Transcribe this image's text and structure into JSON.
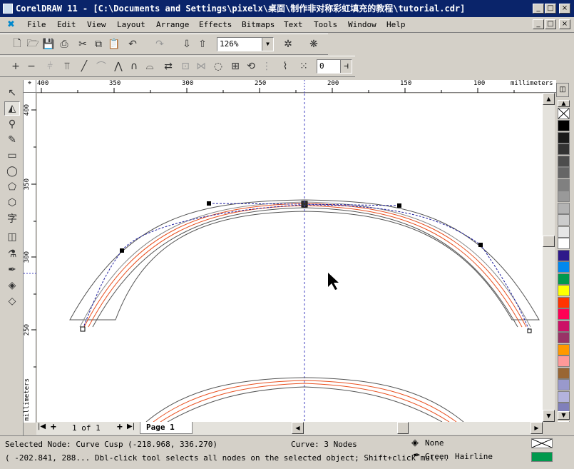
{
  "window": {
    "title": "CorelDRAW 11 - [C:\\Documents and Settings\\pixelx\\桌面\\制作非对称彩虹填充的教程\\tutorial.cdr]",
    "btn_min": "_",
    "btn_max": "□",
    "btn_close": "×"
  },
  "menu": [
    {
      "label": "File"
    },
    {
      "label": "Edit"
    },
    {
      "label": "View"
    },
    {
      "label": "Layout"
    },
    {
      "label": "Arrange"
    },
    {
      "label": "Effects"
    },
    {
      "label": "Bitmaps"
    },
    {
      "label": "Text"
    },
    {
      "label": "Tools"
    },
    {
      "label": "Window"
    },
    {
      "label": "Help"
    }
  ],
  "toolbar": {
    "zoom": "126%",
    "nudge": "0"
  },
  "ruler": {
    "unit": "millimeters",
    "h_labels": [
      "400",
      "350",
      "300",
      "250",
      "200",
      "150",
      "100"
    ],
    "v_labels": [
      "400",
      "350",
      "300",
      "250"
    ]
  },
  "pages": {
    "counter": "1 of 1",
    "tab": "Page 1"
  },
  "status": {
    "selected": "Selected Node: Curve Cusp (-218.968, 336.270)",
    "curve": "Curve: 3 Nodes",
    "fill": "None",
    "outline_color": "Green",
    "outline_width": "Hairline",
    "hint": "( -202.841, 288... Dbl-click tool selects all nodes on the selected object; Shift+click mul..."
  },
  "palette": [
    "#ffffff",
    "#000000",
    "#1a1a1a",
    "#333333",
    "#4d4d4d",
    "#666666",
    "#808080",
    "#999999",
    "#b3b3b3",
    "#cccccc",
    "#e6e6e6",
    "#ffffff",
    "#2e1a8a",
    "#0088ee",
    "#00994d",
    "#ffff00",
    "#ff3300",
    "#ff0055",
    "#cc1166",
    "#993366",
    "#ff9900",
    "#ff9999",
    "#996633",
    "#9999cc",
    "#b3b3dd",
    "#8080bb"
  ],
  "colors": {
    "title_bg": "#0a246a",
    "guide": "#4040c0",
    "outline_orange": "#e85020",
    "outline_green": "#00994d"
  }
}
